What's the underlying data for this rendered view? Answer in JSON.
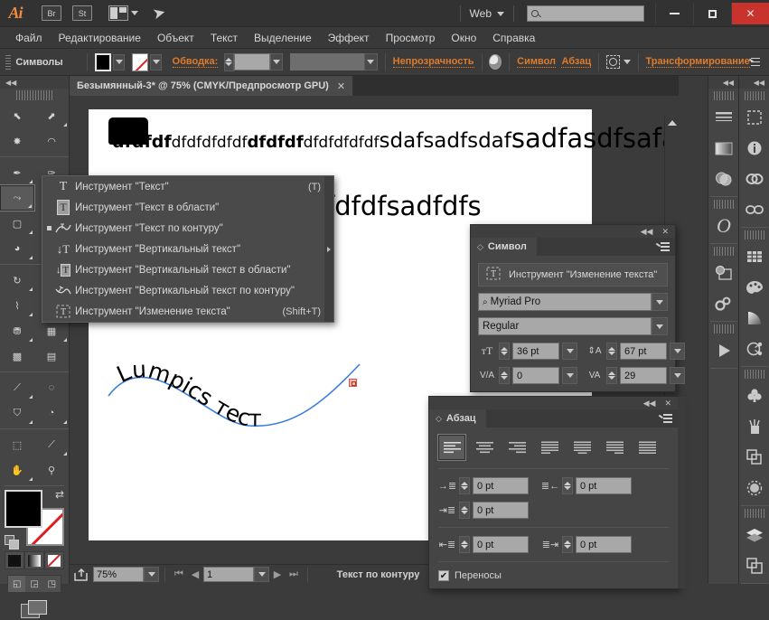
{
  "app": {
    "logo": "Ai",
    "bridge_button": "Br",
    "stock_button": "St",
    "workspace_label": "Web",
    "search_placeholder": "",
    "search_value": ""
  },
  "titlebar_buttons": {
    "minimize": "–",
    "maximize": "□",
    "close": "✕"
  },
  "menubar": {
    "items": [
      {
        "label": "Файл"
      },
      {
        "label": "Редактирование"
      },
      {
        "label": "Объект"
      },
      {
        "label": "Текст"
      },
      {
        "label": "Выделение"
      },
      {
        "label": "Эффект"
      },
      {
        "label": "Просмотр"
      },
      {
        "label": "Окно"
      },
      {
        "label": "Справка"
      }
    ]
  },
  "controlbar": {
    "title": "Символы",
    "stroke_label": "Обводка:",
    "stroke_weight": "",
    "stroke_profile": "",
    "opacity_label": "Непрозрачность",
    "character_label": "Символ",
    "paragraph_label": "Абзац",
    "transform_label": "Трансформирование"
  },
  "toolbox": {
    "tools": [
      {
        "name": "selection-tool",
        "glyph": "➚"
      },
      {
        "name": "direct-selection-tool",
        "glyph": "➘"
      },
      {
        "name": "magic-wand-tool",
        "glyph": "✸"
      },
      {
        "name": "lasso-tool",
        "glyph": "◠"
      },
      {
        "name": "pen-tool",
        "glyph": "✒"
      },
      {
        "name": "add-anchor-point-tool",
        "glyph": "✎"
      },
      {
        "name": "type-on-path-tool",
        "glyph": "∿"
      },
      {
        "name": "line-segment-tool",
        "glyph": "▭"
      },
      {
        "name": "rectangle-tool",
        "glyph": "▢"
      },
      {
        "name": "paintbrush-tool",
        "glyph": "◕"
      },
      {
        "name": "rotate-tool",
        "glyph": "↻"
      },
      {
        "name": "scale-tool",
        "glyph": "⤡"
      },
      {
        "name": "width-tool",
        "glyph": "⌇"
      },
      {
        "name": "free-transform-tool",
        "glyph": "⛶"
      },
      {
        "name": "shape-builder-tool",
        "glyph": "◍"
      },
      {
        "name": "perspective-grid-tool",
        "glyph": "▦"
      },
      {
        "name": "mesh-tool",
        "glyph": "▩"
      },
      {
        "name": "eyedropper-tool",
        "glyph": "⟋"
      },
      {
        "name": "blend-tool",
        "glyph": "◎"
      },
      {
        "name": "symbol-sprayer-tool",
        "glyph": "⛉"
      },
      {
        "name": "column-graph-tool",
        "glyph": "◔"
      },
      {
        "name": "artboard-tool",
        "glyph": "⬚"
      },
      {
        "name": "slice-tool",
        "glyph": "✂"
      },
      {
        "name": "hand-tool",
        "glyph": "✋"
      },
      {
        "name": "zoom-tool",
        "glyph": "🔍"
      }
    ],
    "screen_mode": "change-screen-mode"
  },
  "document": {
    "tab_title": "Безымянный-3* @ 75% (CMYK/Предпросмотр GPU)",
    "tab_close": "✕",
    "canvas": {
      "text_runs": [
        {
          "text": "dfdfdf",
          "size": "s1"
        },
        {
          "text": "dfdfdfdfdf",
          "size": "s2"
        },
        {
          "text": "dfdfdf",
          "size": "s3"
        },
        {
          "text": "dfdfdfdfdf",
          "size": "s4"
        },
        {
          "text": "sdafsadfsdaf",
          "size": "s5"
        },
        {
          "text": "sadfasdfsafa",
          "size": "s6"
        }
      ],
      "second_line": "fdfdfsadfdfs",
      "path_text": "Lumpics тест"
    }
  },
  "flyout_menu": {
    "items": [
      {
        "icon": "type-tool-icon",
        "glyph": "T",
        "label": "Инструмент \"Текст\"",
        "shortcut": "(T)",
        "selected": false
      },
      {
        "icon": "area-type-tool-icon",
        "glyph": "T",
        "label": "Инструмент \"Текст в области\"",
        "shortcut": "",
        "selected": false
      },
      {
        "icon": "type-on-path-tool-icon",
        "glyph": "∿",
        "label": "Инструмент \"Текст по контуру\"",
        "shortcut": "",
        "selected": true
      },
      {
        "icon": "vertical-type-tool-icon",
        "glyph": "T",
        "label": "Инструмент \"Вертикальный текст\"",
        "shortcut": "",
        "selected": false
      },
      {
        "icon": "vertical-area-type-tool-icon",
        "glyph": "T",
        "label": "Инструмент \"Вертикальный текст в области\"",
        "shortcut": "",
        "selected": false
      },
      {
        "icon": "vertical-type-on-path-tool-icon",
        "glyph": "∿",
        "label": "Инструмент \"Вертикальный текст по контуру\"",
        "shortcut": "",
        "selected": false
      },
      {
        "icon": "touch-type-tool-icon",
        "glyph": "T",
        "label": "Инструмент \"Изменение текста\"",
        "shortcut": "(Shift+T)",
        "selected": false
      }
    ]
  },
  "character_panel": {
    "tab_label": "Символ",
    "tool_button": "Инструмент \"Изменение текста\"",
    "font_family": "Myriad Pro",
    "font_style": "Regular",
    "font_size": "36 pt",
    "leading": "67 pt",
    "kerning": "0",
    "tracking": "29"
  },
  "paragraph_panel": {
    "tab_label": "Абзац",
    "align_buttons": [
      {
        "name": "align-left",
        "active": true
      },
      {
        "name": "align-center",
        "active": false
      },
      {
        "name": "align-right",
        "active": false
      },
      {
        "name": "justify-last-left",
        "active": false
      },
      {
        "name": "justify-last-center",
        "active": false
      },
      {
        "name": "justify-last-right",
        "active": false
      },
      {
        "name": "justify-all",
        "active": false
      }
    ],
    "indent_left": "0 pt",
    "indent_right": "0 pt",
    "indent_first_line": "0 pt",
    "space_before": "0 pt",
    "space_after": "0 pt",
    "hyphenate_label": "Переносы",
    "hyphenate_checked": true
  },
  "dock_a": {
    "icons": [
      {
        "name": "stroke-panel-icon",
        "glyph": "≡"
      },
      {
        "name": "gradient-panel-icon",
        "glyph": "▤"
      },
      {
        "name": "transparency-panel-icon",
        "glyph": "◑"
      },
      {
        "name": "character-styles-panel-icon",
        "glyph": "O"
      },
      {
        "name": "image-trace-panel-icon",
        "glyph": "◓"
      },
      {
        "name": "actions-panel-icon",
        "glyph": "⚙"
      },
      {
        "name": "video-panel-icon",
        "glyph": "▶"
      }
    ]
  },
  "dock_b": {
    "icons": [
      {
        "name": "artboards-panel-icon",
        "glyph": "⬚"
      },
      {
        "name": "info-panel-icon",
        "glyph": "i"
      },
      {
        "name": "links-panel-icon",
        "glyph": "∞"
      },
      {
        "name": "links-chain-icon",
        "glyph": "⛓"
      },
      {
        "name": "swatches-grid-panel-icon",
        "glyph": "▦"
      },
      {
        "name": "color-palette-panel-icon",
        "glyph": "🎨"
      },
      {
        "name": "gradient-fan-panel-icon",
        "glyph": "◟"
      },
      {
        "name": "graphic-styles-panel-icon",
        "glyph": "⚛"
      },
      {
        "name": "symbols-panel-icon",
        "glyph": "♣"
      },
      {
        "name": "brushes-panel-icon",
        "glyph": "🖌"
      },
      {
        "name": "pathfinder-panel-icon",
        "glyph": "❐"
      },
      {
        "name": "appearance-panel-icon",
        "glyph": "◯"
      },
      {
        "name": "layers-panel-icon",
        "glyph": "◆"
      },
      {
        "name": "artboard-list-panel-icon",
        "glyph": "❏"
      }
    ]
  },
  "statusbar": {
    "zoom": "75%",
    "artboard_number": "1",
    "status_text": "Текст по контуру"
  },
  "colors": {
    "accent_orange": "#e07b2a",
    "panel_bg": "#454545",
    "app_bg": "#3b3b3b",
    "titlebar_bg": "#323232",
    "field_bg": "#a8a8a8",
    "close_red": "#c8332e",
    "path_blue": "#3b7ddd"
  }
}
